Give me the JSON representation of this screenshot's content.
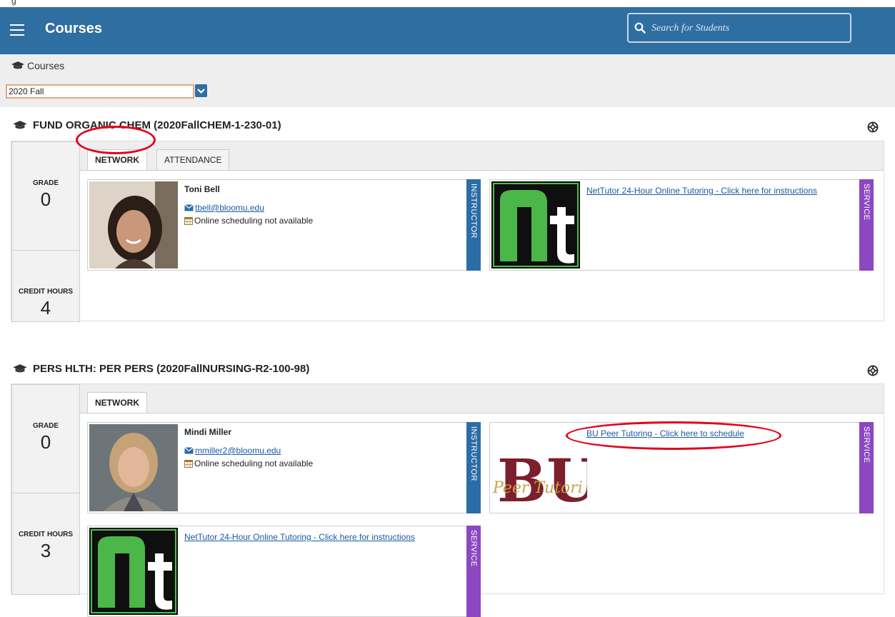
{
  "header": {
    "title": "Courses",
    "search_placeholder": "Search for Students"
  },
  "breadcrumb": {
    "label": "Courses"
  },
  "term_select": {
    "value": "2020 Fall"
  },
  "courses": [
    {
      "title": "FUND ORGANIC CHEM (2020FallCHEM-1-230-01)",
      "grade_label": "GRADE",
      "grade": "0",
      "credit_label": "CREDIT HOURS",
      "credits": "4",
      "tabs": [
        "NETWORK",
        "ATTENDANCE"
      ],
      "instructor": {
        "name": "Toni Bell",
        "email": "tbell@bloomu.edu",
        "scheduling": "Online scheduling not available",
        "role": "INSTRUCTOR"
      },
      "service": {
        "link": "NetTutor 24-Hour Online Tutoring - Click here for instructions",
        "role": "SERVICE"
      }
    },
    {
      "title": "PERS HLTH: PER PERS (2020FallNURSING-R2-100-98)",
      "grade_label": "GRADE",
      "grade": "0",
      "credit_label": "CREDIT HOURS",
      "credits": "3",
      "tabs": [
        "NETWORK"
      ],
      "instructor": {
        "name": "Mindi Miller",
        "email": "mmiller2@bloomu.edu",
        "scheduling": "Online scheduling not available",
        "role": "INSTRUCTOR"
      },
      "service": {
        "link": "BU Peer Tutoring - Click here to schedule",
        "logo_text": "Peer Tutori",
        "role": "SERVICE"
      },
      "service2": {
        "link": "NetTutor 24-Hour Online Tutoring - Click here for instructions",
        "role": "SERVICE"
      }
    }
  ],
  "colors": {
    "header": "#2f6ea1",
    "instructor_tag": "#2b6da6",
    "service_tag": "#8b48c0",
    "highlight": "#e3001b"
  }
}
